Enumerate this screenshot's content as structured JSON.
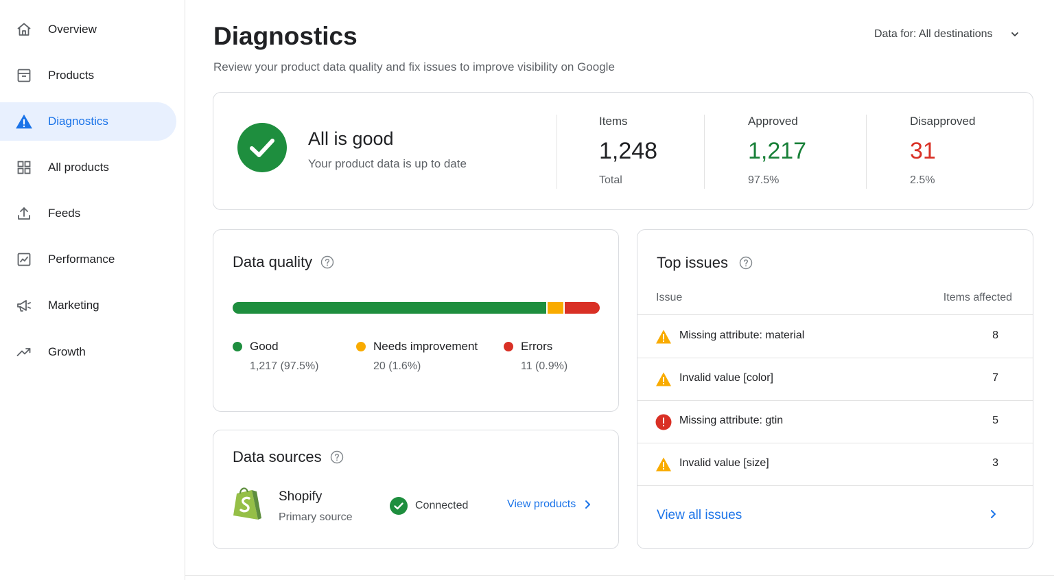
{
  "sidebar": {
    "items": [
      {
        "label": "Overview",
        "icon": "home-icon"
      },
      {
        "label": "Products",
        "icon": "inbox-icon"
      },
      {
        "label": "Diagnostics",
        "icon": "warning-icon",
        "active": true
      },
      {
        "label": "All products",
        "icon": "grid-icon"
      },
      {
        "label": "Feeds",
        "icon": "upload-icon"
      },
      {
        "label": "Performance",
        "icon": "chart-icon"
      },
      {
        "label": "Marketing",
        "icon": "megaphone-icon"
      },
      {
        "label": "Growth",
        "icon": "trending-up-icon"
      }
    ]
  },
  "header": {
    "title": "Diagnostics",
    "subtitle": "Review your product data quality and fix issues to improve visibility on Google",
    "destination_selector": "Data for: All destinations"
  },
  "status": {
    "title": "All is good",
    "description": "Your product data is up to date",
    "stats": [
      {
        "label": "Items",
        "value": "1,248",
        "sub": "Total",
        "color": "#202124"
      },
      {
        "label": "Approved",
        "value": "1,217",
        "sub": "97.5%",
        "color": "#188038"
      },
      {
        "label": "Disapproved",
        "value": "31",
        "sub": "2.5%",
        "color": "#d93025"
      }
    ]
  },
  "data_quality": {
    "title": "Data quality",
    "segments": [
      {
        "label": "Good",
        "detail": "1,217 (97.5%)",
        "fraction": 0.86,
        "color": "#1e8e3e"
      },
      {
        "label": "Needs improvement",
        "detail": "20 (1.6%)",
        "fraction": 0.045,
        "color": "#f9ab00"
      },
      {
        "label": "Errors",
        "detail": "11 (0.9%)",
        "fraction": 0.095,
        "color": "#d93025"
      }
    ]
  },
  "data_sources": {
    "title": "Data sources",
    "source_name": "Shopify",
    "source_role": "Primary source",
    "status": "Connected",
    "link": "View products"
  },
  "top_issues": {
    "title": "Top issues",
    "col_issue": "Issue",
    "col_items": "Items affected",
    "rows": [
      {
        "severity": "warning",
        "name": "Missing attribute: material",
        "count": "8"
      },
      {
        "severity": "warning",
        "name": "Invalid value [color]",
        "count": "7"
      },
      {
        "severity": "error",
        "name": "Missing attribute: gtin",
        "count": "5"
      },
      {
        "severity": "warning",
        "name": "Invalid value [size]",
        "count": "3"
      }
    ],
    "view_all": "View all issues"
  },
  "colors": {
    "accent": "#1a73e8",
    "active_nav_bg": "#e8f0fe",
    "good": "#1e8e3e",
    "warning": "#f9ab00",
    "error": "#d93025"
  }
}
